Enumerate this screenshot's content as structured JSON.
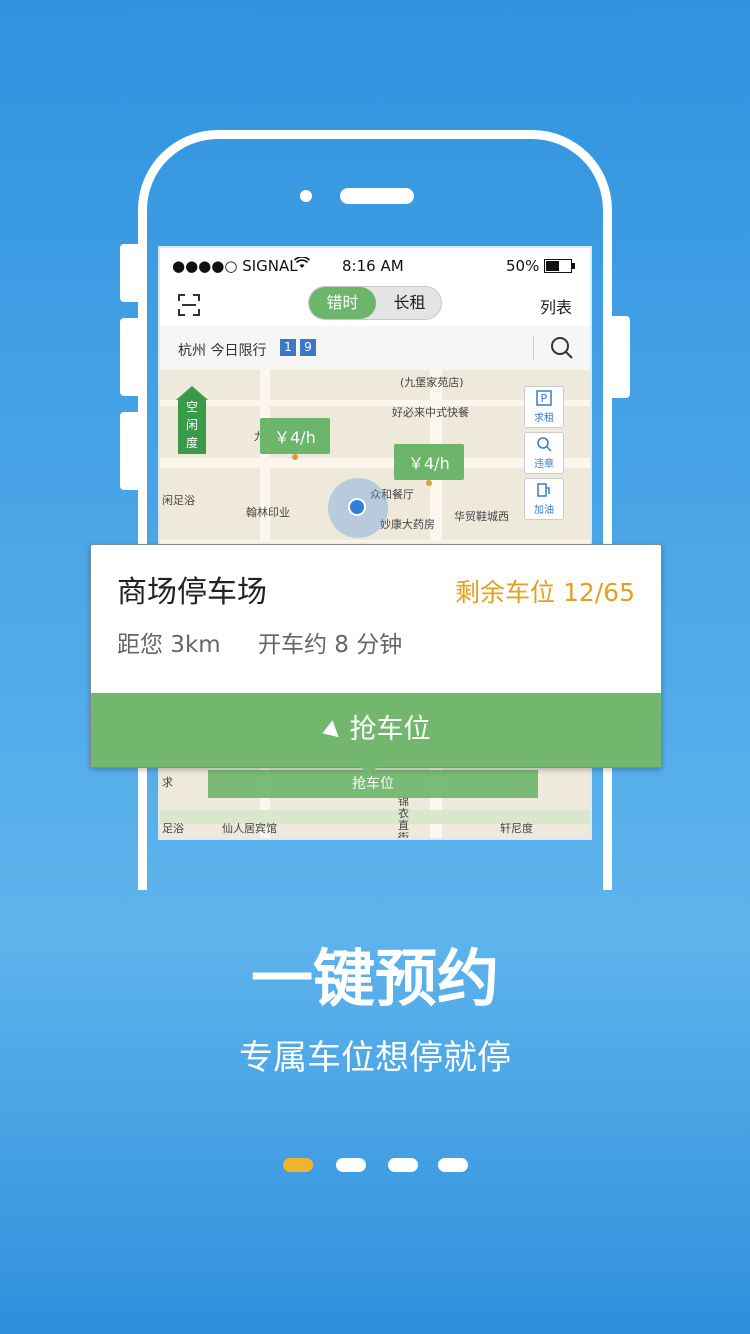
{
  "status": {
    "signal": "●●●●○ SIGNAL",
    "time": "8:16 AM",
    "battery": "50%"
  },
  "topbar": {
    "scan_icon": "scan-icon",
    "tab_active": "错时",
    "tab_inactive": "长租",
    "list_link": "列表"
  },
  "limit": {
    "text": "杭州 今日限行",
    "plate1": "1",
    "plate2": "9"
  },
  "map": {
    "idle_chars": [
      "空",
      "闲",
      "度"
    ],
    "price1": "￥4/h",
    "price2": "￥4/h",
    "pois": {
      "p1": "(九堡家苑店)",
      "p2": "好必来中式快餐",
      "p3": "众和餐厅",
      "p4": "妙康大药房",
      "p5": "华贸鞋城西",
      "p6": "翰林印业",
      "p7": "闲足浴",
      "p8": "仙人居宾馆",
      "p9": "足浴",
      "p10": "轩尼度",
      "p11": "锦衣直街",
      "p12": "九",
      "p13": "求"
    },
    "tools": {
      "rent": "求租",
      "violation": "违章",
      "gas": "加油"
    },
    "ghost_button": "抢车位"
  },
  "card": {
    "title": "商场停车场",
    "remaining": "剩余车位 12/65",
    "distance": "距您 3km",
    "drive_time": "开车约 8 分钟",
    "button": "抢车位"
  },
  "headline": "一键预约",
  "subline": "专属车位想停就停",
  "colors": {
    "accent_green": "#72b76d",
    "accent_orange": "#e4a021",
    "page_dot_active": "#f0b32e",
    "background_blue": "#2f93df"
  },
  "pager": {
    "count": 4,
    "active_index": 0
  }
}
